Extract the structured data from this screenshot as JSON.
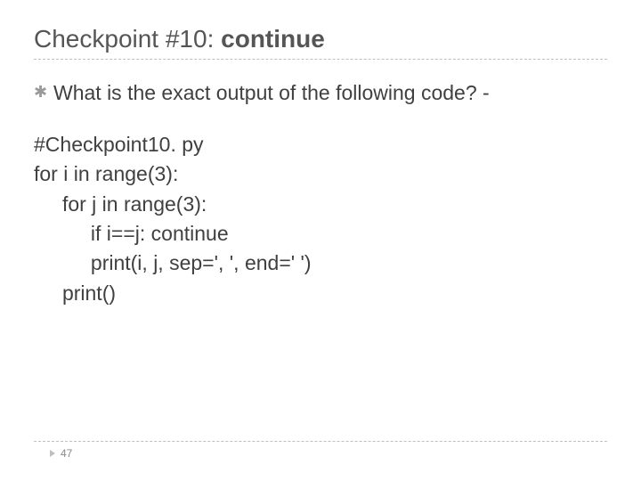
{
  "title": {
    "prefix": "Checkpoint #10: ",
    "keyword": "continue"
  },
  "bullet": {
    "text": "What is the exact output of the following code? -"
  },
  "code": {
    "lines": [
      "#Checkpoint10. py",
      "for i in range(3):",
      "     for j in range(3):",
      "          if i==j: continue",
      "          print(i, j, sep=', ', end=' ')",
      "     print()"
    ]
  },
  "page_number": "47"
}
